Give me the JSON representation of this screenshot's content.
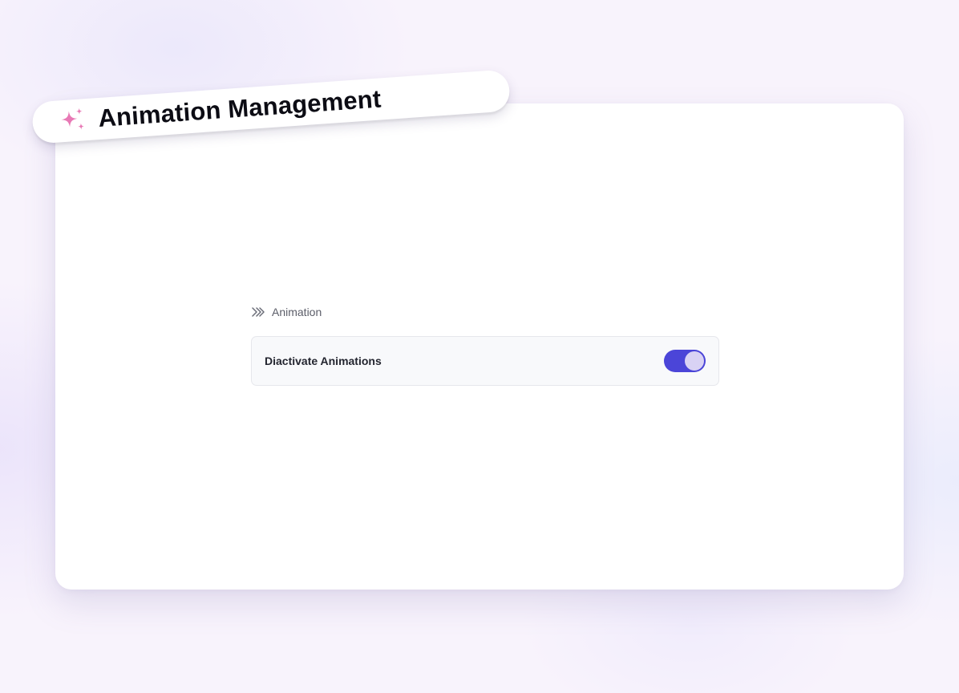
{
  "header": {
    "title": "Animation Management",
    "icon": "sparkles-icon",
    "icon_color": "#e879b5"
  },
  "section": {
    "label": "Animation",
    "icon": "double-chevron-icon"
  },
  "settings": [
    {
      "label": "Diactivate Animations",
      "enabled": true,
      "toggle_color": "#4b45d8"
    }
  ]
}
